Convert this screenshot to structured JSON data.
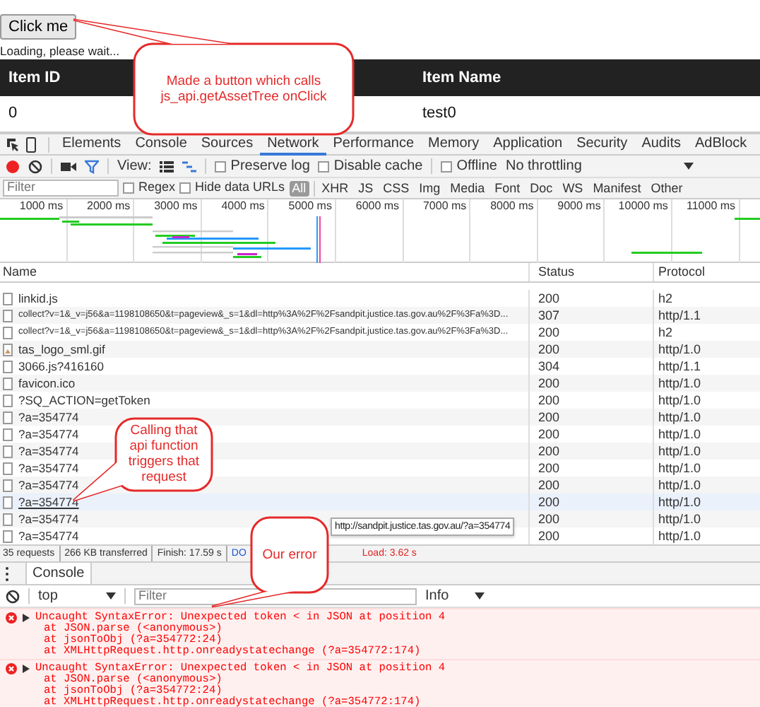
{
  "page": {
    "button": "Click me",
    "loading": "Loading, please wait...",
    "table": {
      "columns": [
        "Item ID",
        "Item Name"
      ],
      "rows": [
        [
          "0",
          "test0"
        ]
      ]
    }
  },
  "devtools": {
    "tabs": [
      {
        "label": "Elements",
        "selected": false
      },
      {
        "label": "Console",
        "selected": false
      },
      {
        "label": "Sources",
        "selected": false
      },
      {
        "label": "Network",
        "selected": true
      },
      {
        "label": "Performance",
        "selected": false
      },
      {
        "label": "Memory",
        "selected": false
      },
      {
        "label": "Application",
        "selected": false
      },
      {
        "label": "Security",
        "selected": false
      },
      {
        "label": "Audits",
        "selected": false
      },
      {
        "label": "AdBlock",
        "selected": false
      }
    ],
    "toolbar": {
      "recording": true,
      "filter_active": true,
      "view_label": "View:",
      "checkboxes": [
        {
          "label": "Preserve log",
          "checked": false
        },
        {
          "label": "Disable cache",
          "checked": false
        },
        {
          "label": "Offline",
          "checked": false
        }
      ],
      "throttling": "No throttling"
    },
    "filter_bar": {
      "placeholder": "Filter",
      "checkboxes": [
        {
          "label": "Regex",
          "checked": false
        },
        {
          "label": "Hide data URLs",
          "checked": false
        }
      ],
      "types": [
        {
          "label": "All",
          "selected": true
        },
        {
          "label": "XHR",
          "selected": false
        },
        {
          "label": "JS",
          "selected": false
        },
        {
          "label": "CSS",
          "selected": false
        },
        {
          "label": "Img",
          "selected": false
        },
        {
          "label": "Media",
          "selected": false
        },
        {
          "label": "Font",
          "selected": false
        },
        {
          "label": "Doc",
          "selected": false
        },
        {
          "label": "WS",
          "selected": false
        },
        {
          "label": "Manifest",
          "selected": false
        },
        {
          "label": "Other",
          "selected": false
        }
      ]
    },
    "timeline": {
      "ticks": [
        "1000 ms",
        "2000 ms",
        "3000 ms",
        "4000 ms",
        "5000 ms",
        "6000 ms",
        "7000 ms",
        "8000 ms",
        "9000 ms",
        "10000 ms",
        "11000 ms"
      ]
    },
    "requests": {
      "columns": [
        "Name",
        "Status",
        "Protocol"
      ],
      "rows": [
        {
          "name": "linkid.js",
          "status": "200",
          "protocol": "h2",
          "kind": "file",
          "hovered": false
        },
        {
          "name": "collect?v=1&_v=j56&a=1198108650&t=pageview&_s=1&dl=http%3A%2F%2Fsandpit.justice.tas.gov.au%2F%3Fa%3D...",
          "status": "307",
          "protocol": "http/1.1",
          "kind": "file",
          "hovered": false
        },
        {
          "name": "collect?v=1&_v=j56&a=1198108650&t=pageview&_s=1&dl=http%3A%2F%2Fsandpit.justice.tas.gov.au%2F%3Fa%3D...",
          "status": "200",
          "protocol": "h2",
          "kind": "file",
          "hovered": false
        },
        {
          "name": "tas_logo_sml.gif",
          "status": "200",
          "protocol": "http/1.0",
          "kind": "image",
          "hovered": false
        },
        {
          "name": "3066.js?416160",
          "status": "304",
          "protocol": "http/1.1",
          "kind": "file",
          "hovered": false
        },
        {
          "name": "favicon.ico",
          "status": "200",
          "protocol": "http/1.0",
          "kind": "file",
          "hovered": false
        },
        {
          "name": "?SQ_ACTION=getToken",
          "status": "200",
          "protocol": "http/1.0",
          "kind": "file",
          "hovered": false
        },
        {
          "name": "?a=354774",
          "status": "200",
          "protocol": "http/1.0",
          "kind": "file",
          "hovered": false
        },
        {
          "name": "?a=354774",
          "status": "200",
          "protocol": "http/1.0",
          "kind": "file",
          "hovered": false
        },
        {
          "name": "?a=354774",
          "status": "200",
          "protocol": "http/1.0",
          "kind": "file",
          "hovered": false
        },
        {
          "name": "?a=354774",
          "status": "200",
          "protocol": "http/1.0",
          "kind": "file",
          "hovered": false
        },
        {
          "name": "?a=354774",
          "status": "200",
          "protocol": "http/1.0",
          "kind": "file",
          "hovered": false
        },
        {
          "name": "?a=354774",
          "status": "200",
          "protocol": "http/1.0",
          "kind": "file",
          "hovered": true
        },
        {
          "name": "?a=354774",
          "status": "200",
          "protocol": "http/1.0",
          "kind": "file",
          "hovered": false
        },
        {
          "name": "?a=354774",
          "status": "200",
          "protocol": "http/1.0",
          "kind": "file",
          "hovered": false
        }
      ]
    },
    "summary": {
      "parts": [
        "35 requests",
        "266 KB transferred",
        "Finish: 17.59 s"
      ],
      "dom": "DO",
      "load": "Load: 3.62 s"
    },
    "tooltip": "http://sandpit.justice.tas.gov.au/?a=354774",
    "console": {
      "tab": "Console",
      "context": "top",
      "placeholder": "Filter",
      "level": "Info",
      "errors": [
        {
          "message": "Uncaught SyntaxError: Unexpected token < in JSON at position 4",
          "trace": [
            {
              "text": "at JSON.parse (<anonymous>)"
            },
            {
              "text": "at jsonToObj (",
              "link": "?a=354772:24",
              "after": ")"
            },
            {
              "text": "at XMLHttpRequest.http.onreadystatechange (",
              "link": "?a=354772:174",
              "after": ")"
            }
          ]
        },
        {
          "message": "Uncaught SyntaxError: Unexpected token < in JSON at position 4",
          "trace": [
            {
              "text": "at JSON.parse (<anonymous>)"
            },
            {
              "text": "at jsonToObj (",
              "link": "?a=354772:24",
              "after": ")"
            },
            {
              "text": "at XMLHttpRequest.http.onreadystatechange (",
              "link": "?a=354772:174",
              "after": ")"
            }
          ]
        }
      ]
    }
  },
  "callouts": [
    "Made a button which calls js_api.getAssetTree onClick",
    "Calling that api function triggers that request",
    "Our error"
  ]
}
